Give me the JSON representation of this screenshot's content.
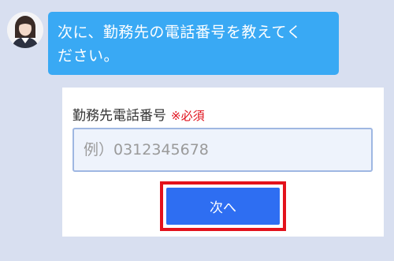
{
  "chat": {
    "avatar_icon": "person-icon",
    "bubble_line_1": "次に、勤務先の電話番号を教えてく",
    "bubble_line_2": "ださい。",
    "bubble_color": "#39a9f4"
  },
  "form": {
    "label": "勤務先電話番号",
    "required_mark": "※必須",
    "phone_placeholder": "例）0312345678",
    "phone_value": "",
    "next_label": "次へ",
    "button_color": "#2e6ef2",
    "highlight_color": "#e3121c"
  }
}
